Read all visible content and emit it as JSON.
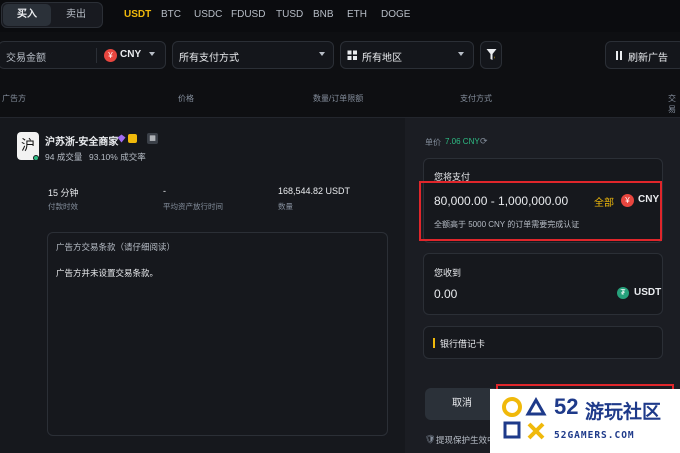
{
  "tabs": {
    "buy": "买入",
    "sell": "卖出"
  },
  "coins": [
    "USDT",
    "BTC",
    "USDC",
    "FDUSD",
    "TUSD",
    "BNB",
    "ETH",
    "DOGE"
  ],
  "filters": {
    "amount_placeholder": "交易金额",
    "currency": "CNY",
    "currency_symbol": "¥",
    "payment": "所有支付方式",
    "region": "所有地区",
    "refresh": "刷新广告"
  },
  "columns": [
    "广告方",
    "价格",
    "数量/订单限额",
    "支付方式",
    "交易"
  ],
  "merchant": {
    "avatar_char": "沪",
    "name": "沪苏浙-安全商家",
    "orders": "94 成交量",
    "completion": "93.10% 成交率",
    "pay_time_value": "15 分钟",
    "pay_time_label": "付款时效",
    "release_value": "-",
    "release_label": "平均资产放行时间",
    "quantity_value": "168,544.82 USDT",
    "quantity_label": "数量",
    "terms_title": "广告方交易条款（请仔细阅读）",
    "terms_body": "广告方并未设置交易条款。"
  },
  "order": {
    "unit_price_label": "单价",
    "unit_price_value": "7.06 CNY",
    "pay_label": "您将支付",
    "pay_value": "80,000.00 - 1,000,000.00",
    "all_label": "全部",
    "pay_currency": "CNY",
    "pay_hint": "全额高于 5000 CNY 的订单需要完成认证",
    "receive_label": "您收到",
    "receive_value": "0.00",
    "receive_currency": "USDT",
    "method": "银行借记卡",
    "cancel": "取消",
    "protect": "提现保护生效中"
  },
  "watermark": {
    "number": "52",
    "name": "游玩社区",
    "domain": "52GAMERS.COM"
  },
  "colors": {
    "accent": "#f0b90b",
    "green": "#2ebd85",
    "red_box": "#e0262b",
    "yen": "#e8463f",
    "tether": "#26a17b"
  }
}
